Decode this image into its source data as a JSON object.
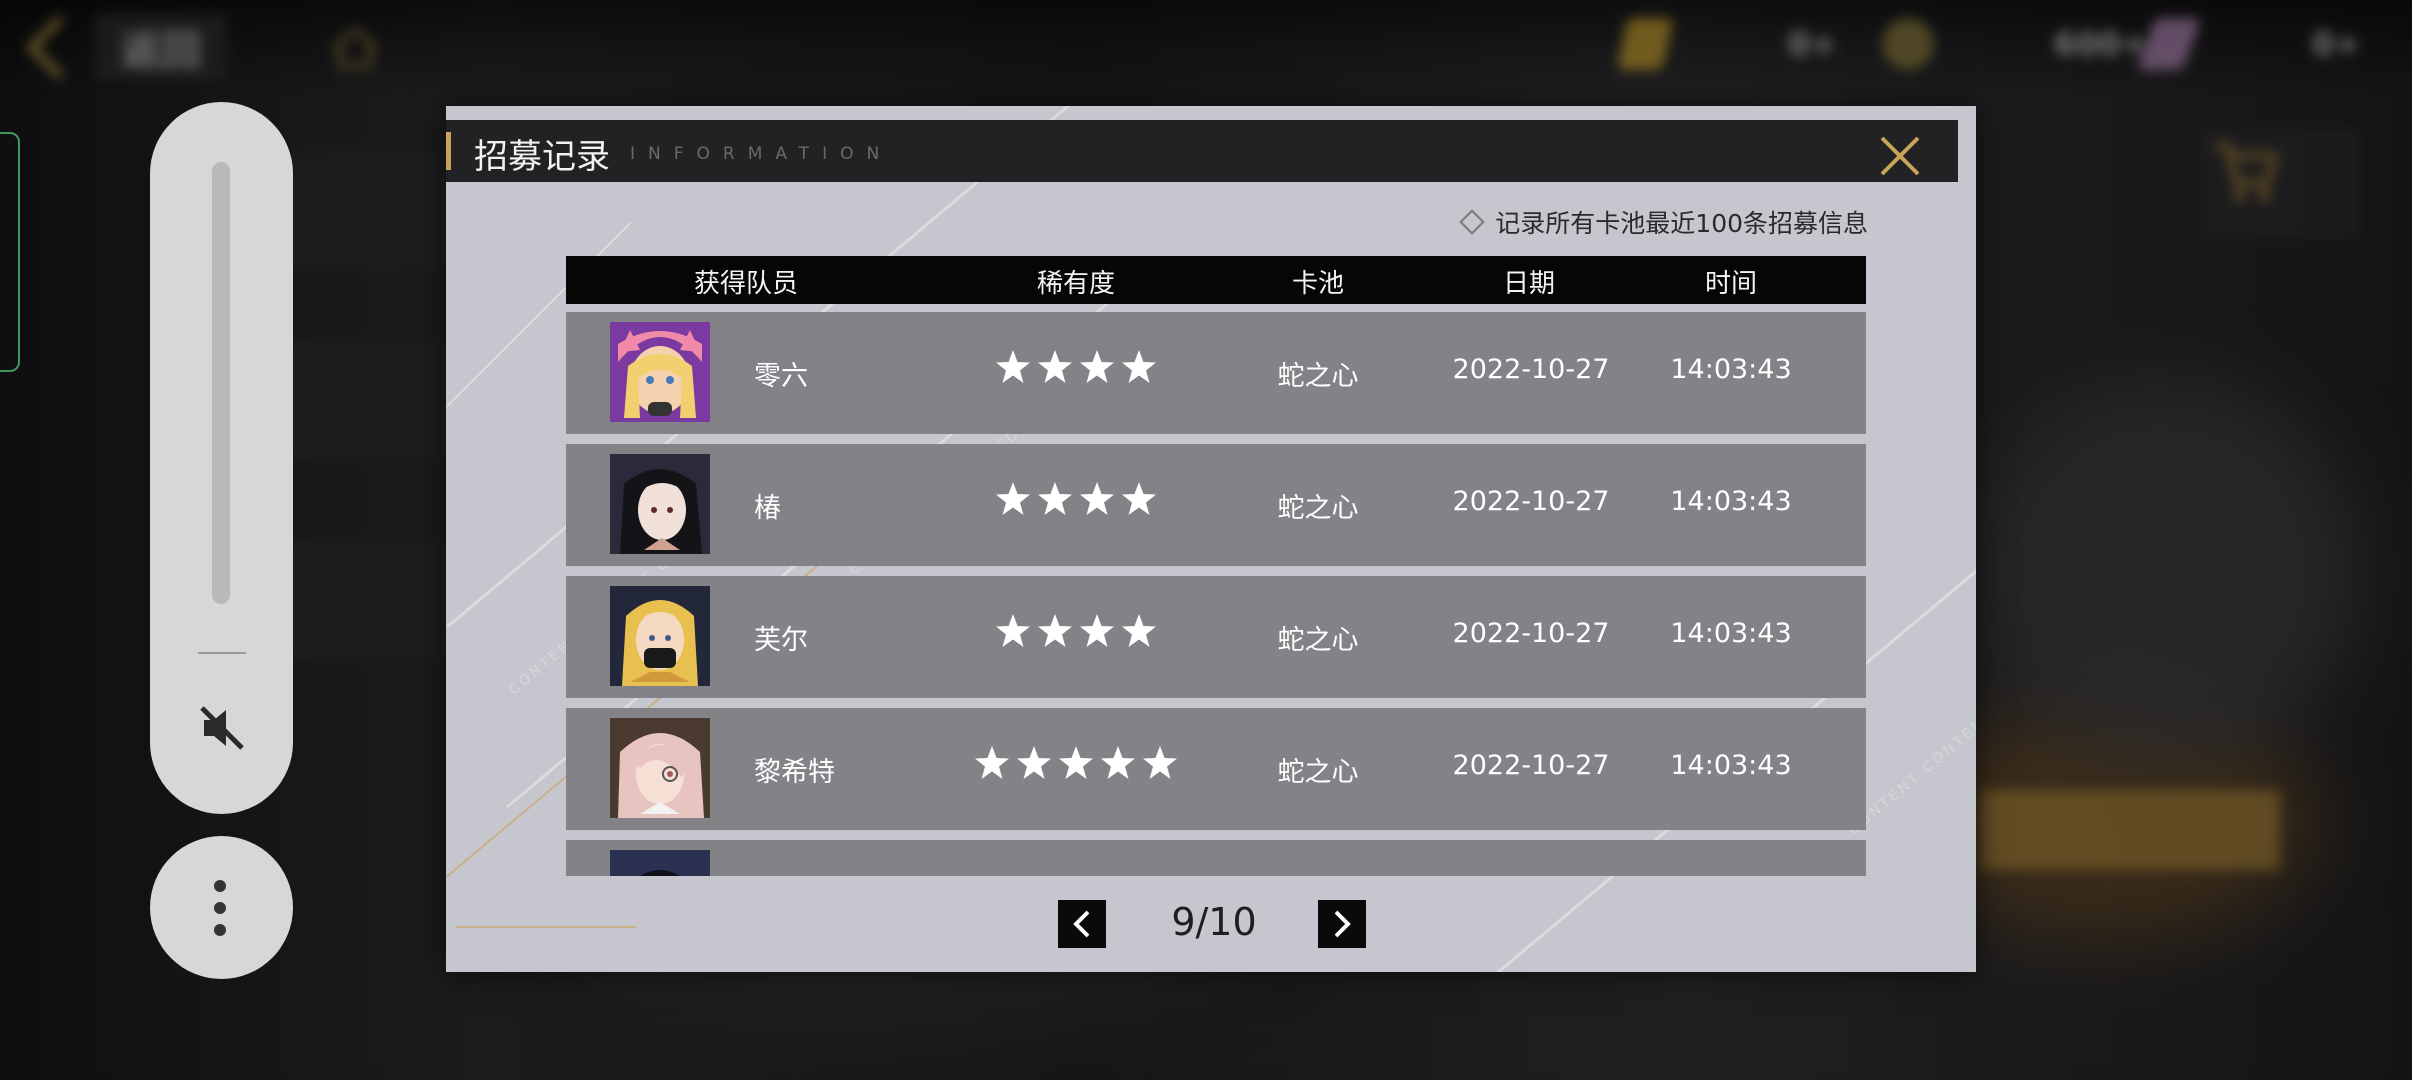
{
  "background": {
    "back_label": "返回",
    "resources": [
      {
        "icon": "ticket-icon",
        "value": "0+"
      },
      {
        "icon": "coin-icon",
        "value": "600+"
      },
      {
        "icon": "gem-icon",
        "value": "0+"
      }
    ]
  },
  "dialog": {
    "title": "招募记录",
    "subtitle": "INFORMATION",
    "note": "记录所有卡池最近100条招募信息",
    "columns": {
      "member": "获得队员",
      "rarity": "稀有度",
      "pool": "卡池",
      "date": "日期",
      "time": "时间"
    },
    "rows": [
      {
        "name": "零六",
        "stars": 4,
        "pool": "蛇之心",
        "date": "2022-10-27",
        "time": "14:03:43"
      },
      {
        "name": "椿",
        "stars": 4,
        "pool": "蛇之心",
        "date": "2022-10-27",
        "time": "14:03:43"
      },
      {
        "name": "芙尔",
        "stars": 4,
        "pool": "蛇之心",
        "date": "2022-10-27",
        "time": "14:03:43"
      },
      {
        "name": "黎希特",
        "stars": 5,
        "pool": "蛇之心",
        "date": "2022-10-27",
        "time": "14:03:43"
      },
      {
        "name": "",
        "stars": 0,
        "pool": "",
        "date": "",
        "time": ""
      }
    ],
    "pager": {
      "current": 9,
      "total": 10,
      "label": "9/10"
    }
  },
  "colors": {
    "accent_gold": "#c9a35a",
    "dialog_bg": "#c6c6ce",
    "row_bg": "#828287",
    "header_bg": "#060606"
  }
}
